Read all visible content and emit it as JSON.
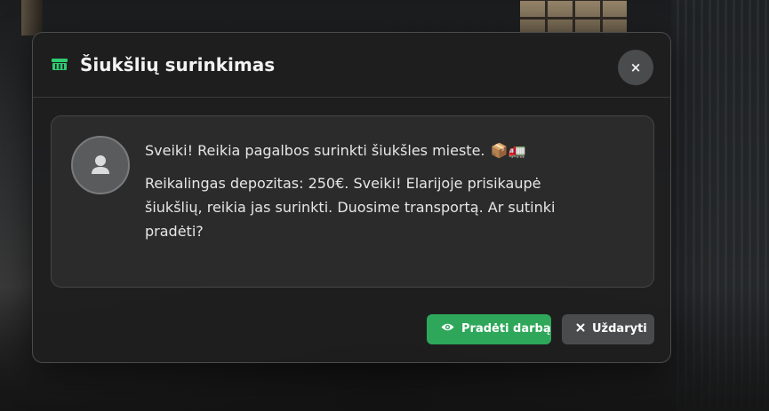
{
  "modal": {
    "title": "Šiukšlių surinkimas",
    "title_icon": "dumpster-icon",
    "close_symbol": "×",
    "accent_color": "#2ea75a"
  },
  "message": {
    "avatar_icon": "user-icon",
    "line1": "Sveiki! Reikia pagalbos surinkti šiukšles mieste.",
    "line1_emoji": "📦🚛",
    "line2": "Reikalingas depozitas: 250€. Sveiki! Elarijoje prisikaupė šiukšlių, reikia jas surinkti. Duosime transportą. Ar sutinki pradėti?"
  },
  "buttons": {
    "start_label": "Pradėti darbą",
    "start_icon": "eye-icon",
    "close_label": "Uždaryti",
    "close_icon": "close-icon",
    "start_color": "#2ea75a",
    "close_color": "#4a4b4d"
  }
}
